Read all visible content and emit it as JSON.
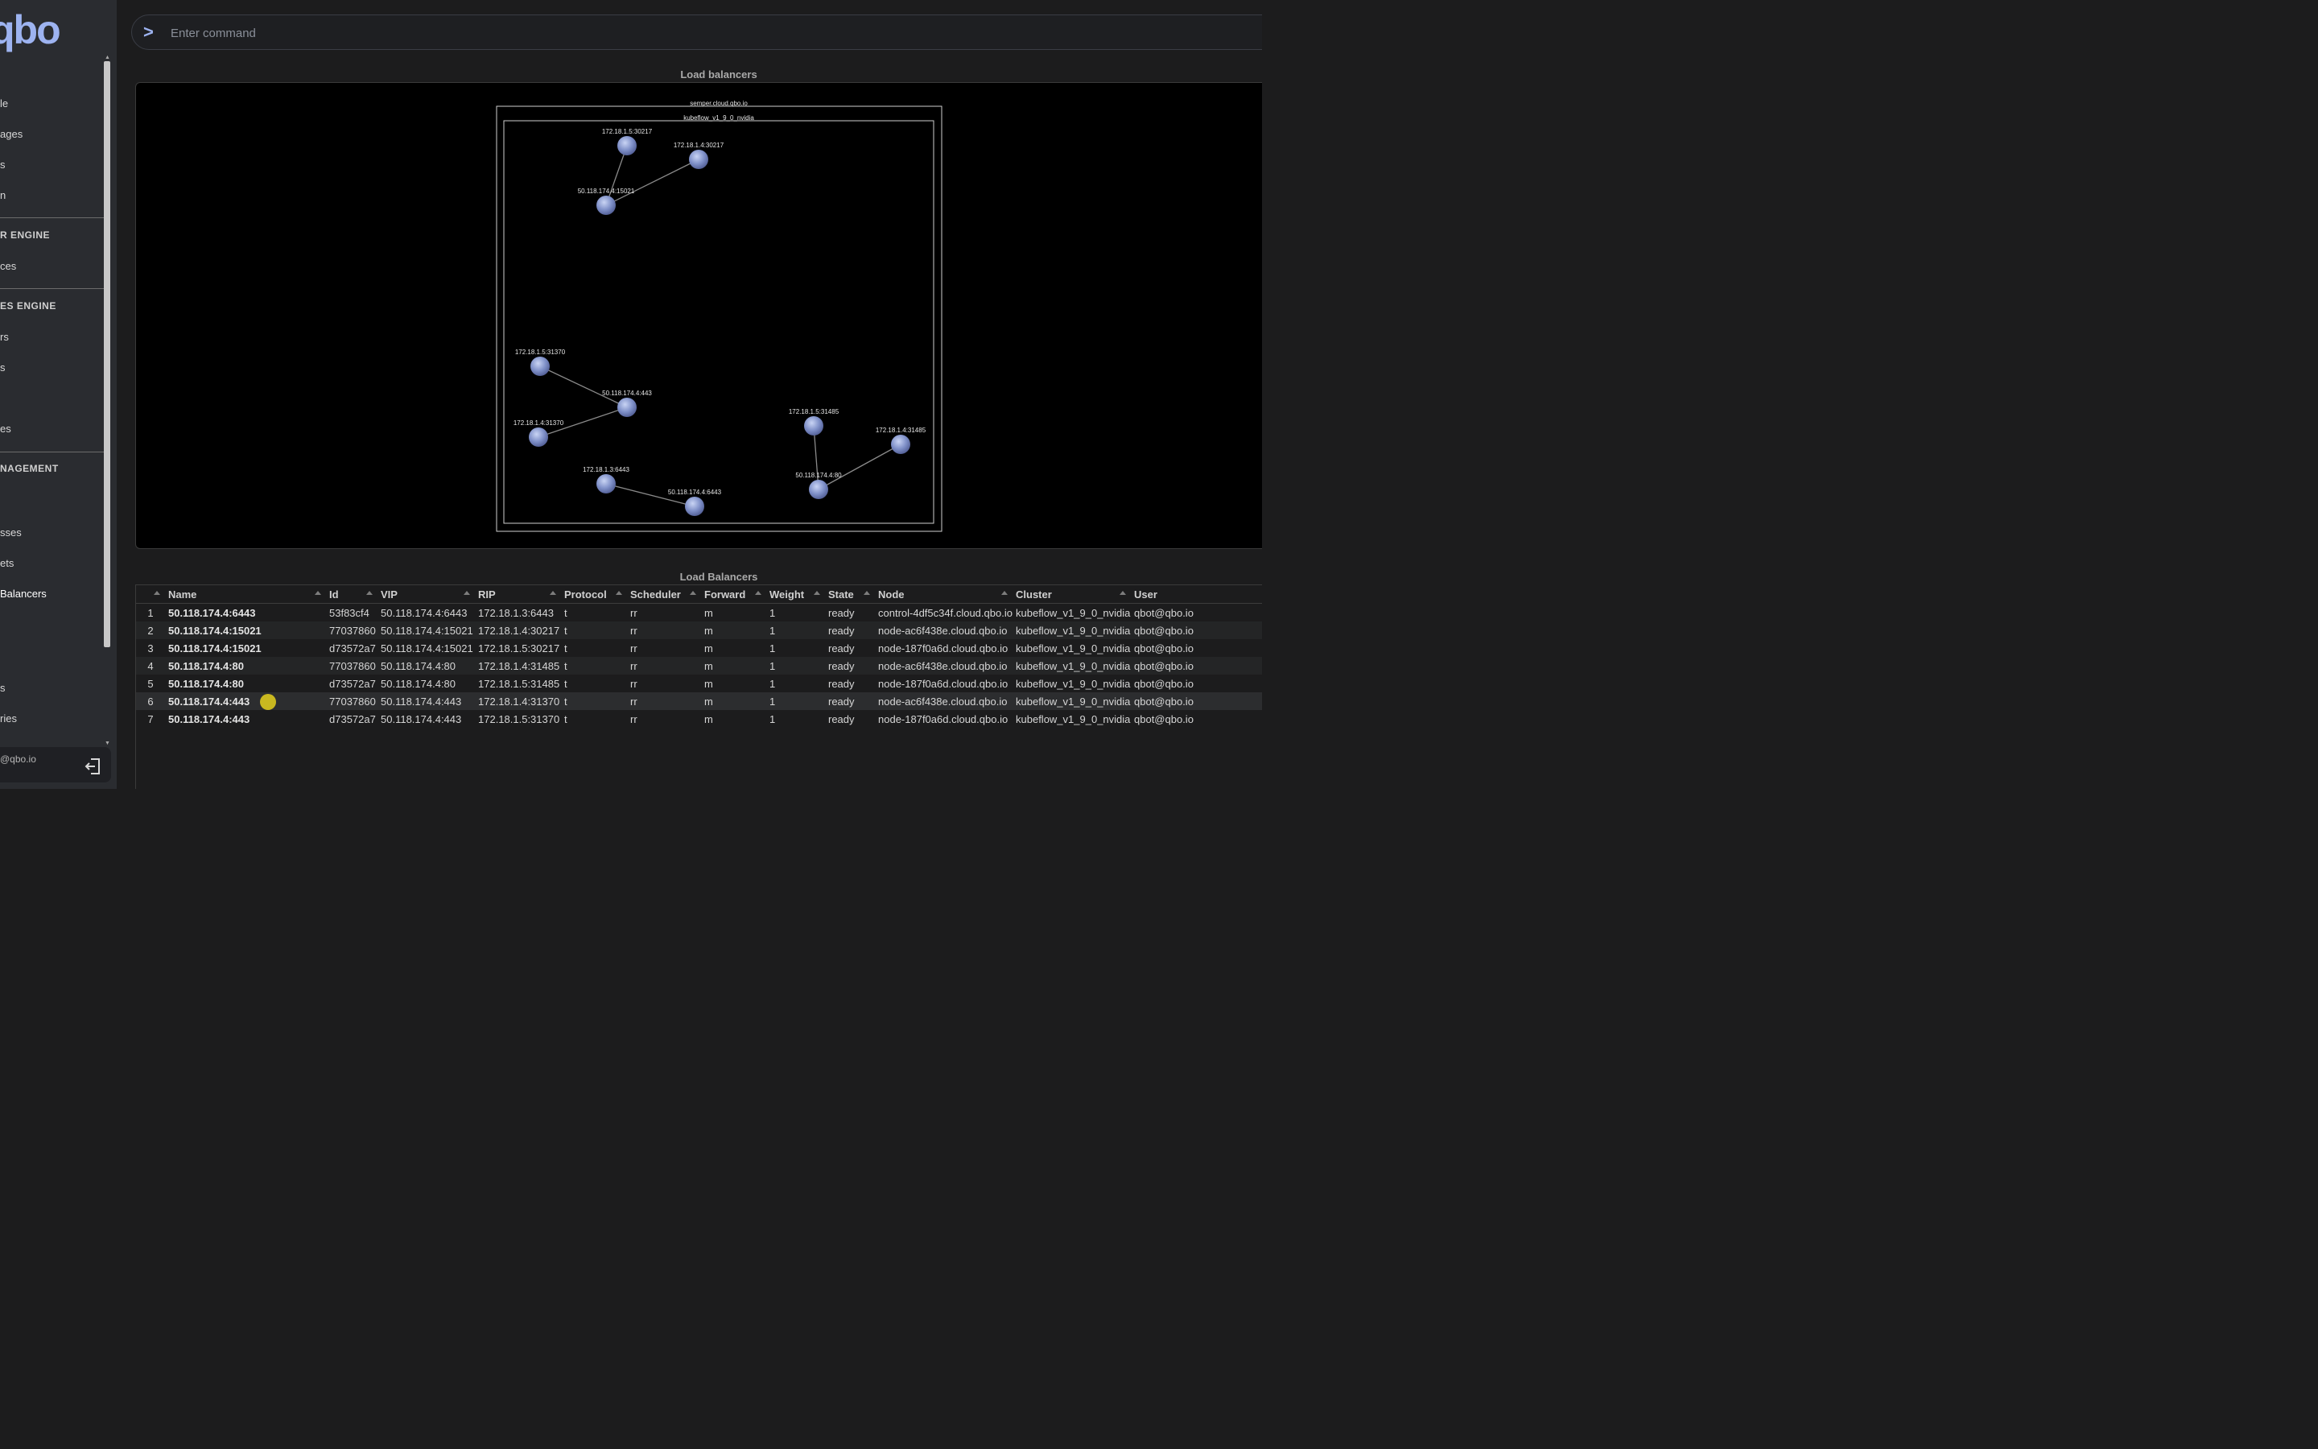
{
  "sidebar": {
    "logo": "qbo",
    "items": [
      {
        "label": "le"
      },
      {
        "label": "ages"
      },
      {
        "label": "s"
      },
      {
        "label": "n"
      },
      {
        "label": "ces"
      },
      {
        "label": "rs"
      },
      {
        "label": "s"
      },
      {
        "label": "es"
      },
      {
        "label": "sses"
      },
      {
        "label": "ets"
      },
      {
        "label": "Balancers"
      },
      {
        "label": "s"
      },
      {
        "label": "ries"
      }
    ],
    "sections": [
      {
        "label": "R ENGINE"
      },
      {
        "label": "ES ENGINE"
      },
      {
        "label": "NAGEMENT"
      }
    ],
    "user_email": "@qbo.io"
  },
  "command": {
    "prompt": ">",
    "placeholder": "Enter command"
  },
  "graph": {
    "title": "Load balancers",
    "outer_label": "semper.cloud.qbo.io",
    "inner_label": "kubeflow_v1_9_0_nvidia",
    "nodes": [
      {
        "id": "a1",
        "label": "172.18.1.5:30217"
      },
      {
        "id": "a2",
        "label": "172.18.1.4:30217"
      },
      {
        "id": "a3",
        "label": "50.118.174.4:15021"
      },
      {
        "id": "b1",
        "label": "172.18.1.5:31370"
      },
      {
        "id": "b2",
        "label": "50.118.174.4:443"
      },
      {
        "id": "b3",
        "label": "172.18.1.4:31370"
      },
      {
        "id": "c1",
        "label": "172.18.1.3:6443"
      },
      {
        "id": "c2",
        "label": "50.118.174.4:6443"
      },
      {
        "id": "d1",
        "label": "172.18.1.5:31485"
      },
      {
        "id": "d2",
        "label": "172.18.1.4:31485"
      },
      {
        "id": "d3",
        "label": "50.118.174.4:80"
      }
    ],
    "edges": [
      [
        "a1",
        "a3"
      ],
      [
        "a2",
        "a3"
      ],
      [
        "b1",
        "b2"
      ],
      [
        "b3",
        "b2"
      ],
      [
        "c1",
        "c2"
      ],
      [
        "d1",
        "d3"
      ],
      [
        "d2",
        "d3"
      ]
    ]
  },
  "table": {
    "title": "Load Balancers",
    "columns": [
      "",
      "Name",
      "Id",
      "VIP",
      "RIP",
      "Protocol",
      "Scheduler",
      "Forward",
      "Weight",
      "State",
      "Node",
      "Cluster",
      "User"
    ],
    "rows": [
      [
        "1",
        "50.118.174.4:6443",
        "53f83cf4",
        "50.118.174.4:6443",
        "172.18.1.3:6443",
        "t",
        "rr",
        "m",
        "1",
        "ready",
        "control-4df5c34f.cloud.qbo.io",
        "kubeflow_v1_9_0_nvidia",
        "qbot@qbo.io"
      ],
      [
        "2",
        "50.118.174.4:15021",
        "77037860",
        "50.118.174.4:15021",
        "172.18.1.4:30217",
        "t",
        "rr",
        "m",
        "1",
        "ready",
        "node-ac6f438e.cloud.qbo.io",
        "kubeflow_v1_9_0_nvidia",
        "qbot@qbo.io"
      ],
      [
        "3",
        "50.118.174.4:15021",
        "d73572a7",
        "50.118.174.4:15021",
        "172.18.1.5:30217",
        "t",
        "rr",
        "m",
        "1",
        "ready",
        "node-187f0a6d.cloud.qbo.io",
        "kubeflow_v1_9_0_nvidia",
        "qbot@qbo.io"
      ],
      [
        "4",
        "50.118.174.4:80",
        "77037860",
        "50.118.174.4:80",
        "172.18.1.4:31485",
        "t",
        "rr",
        "m",
        "1",
        "ready",
        "node-ac6f438e.cloud.qbo.io",
        "kubeflow_v1_9_0_nvidia",
        "qbot@qbo.io"
      ],
      [
        "5",
        "50.118.174.4:80",
        "d73572a7",
        "50.118.174.4:80",
        "172.18.1.5:31485",
        "t",
        "rr",
        "m",
        "1",
        "ready",
        "node-187f0a6d.cloud.qbo.io",
        "kubeflow_v1_9_0_nvidia",
        "qbot@qbo.io"
      ],
      [
        "6",
        "50.118.174.4:443",
        "77037860",
        "50.118.174.4:443",
        "172.18.1.4:31370",
        "t",
        "rr",
        "m",
        "1",
        "ready",
        "node-ac6f438e.cloud.qbo.io",
        "kubeflow_v1_9_0_nvidia",
        "qbot@qbo.io"
      ],
      [
        "7",
        "50.118.174.4:443",
        "d73572a7",
        "50.118.174.4:443",
        "172.18.1.5:31370",
        "t",
        "rr",
        "m",
        "1",
        "ready",
        "node-187f0a6d.cloud.qbo.io",
        "kubeflow_v1_9_0_nvidia",
        "qbot@qbo.io"
      ]
    ]
  }
}
